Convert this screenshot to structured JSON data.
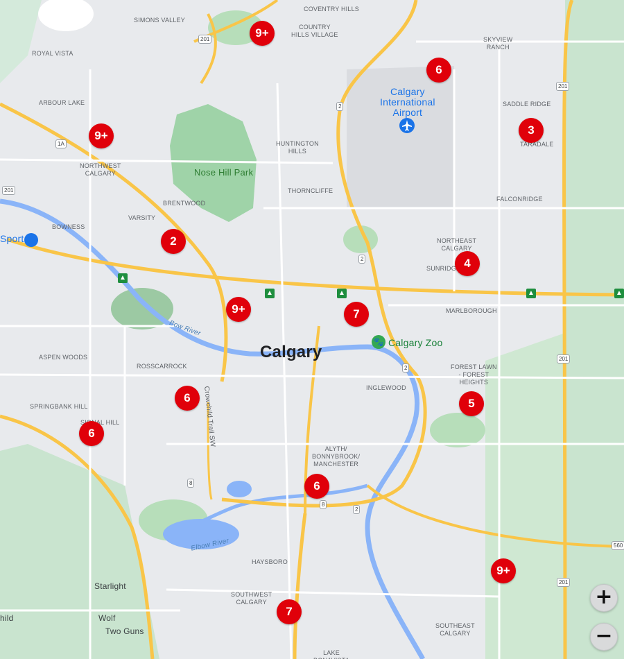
{
  "map": {
    "city_label": "Calgary",
    "park_label": "Nose Hill Park",
    "airport_label": "Calgary\nInternational\nAirport",
    "zoo_label": "Calgary Zoo",
    "sport_label": "Sport",
    "river_bow": "Bow River",
    "river_elbow": "Elbow River",
    "road_crowchild": "Crowchild Trail SW",
    "neighborhoods": {
      "simons_valley": "SIMONS VALLEY",
      "coventry_hills": "COVENTRY HILLS",
      "country_hills_village": "COUNTRY\nHILLS VILLAGE",
      "royal_vista": "ROYAL VISTA",
      "skyview_ranch": "SKYVIEW\nRANCH",
      "arbour_lake": "ARBOUR LAKE",
      "saddle_ridge": "SADDLE RIDGE",
      "taradale": "TARADALE",
      "huntington_hills": "HUNTINGTON\nHILLS",
      "northwest_calgary": "NORTHWEST\nCALGARY",
      "thorncliffe": "THORNCLIFFE",
      "falconridge": "FALCONRIDGE",
      "brentwood": "BRENTWOOD",
      "varsity": "VARSITY",
      "bowness": "BOWNESS",
      "northeast_calgary": "NORTHEAST\nCALGARY",
      "sunridge": "SUNRIDGE",
      "marlborough": "MARLBOROUGH",
      "aspen_woods": "ASPEN WOODS",
      "rosscarrock": "ROSSCARROCK",
      "forest_lawn": "FOREST LAWN\n- FOREST\nHEIGHTS",
      "inglewood": "INGLEWOOD",
      "springbank_hill": "SPRINGBANK HILL",
      "signal_hill": "SIGNAL HILL",
      "alyth": "ALYTH/\nBONNYBROOK/\nMANCHESTER",
      "haysboro": "HAYSBORO",
      "southwest_calgary": "SOUTHWEST\nCALGARY",
      "southeast_calgary": "SOUTHEAST\nCALGARY",
      "lake_bonavista": "LAKE\nBONAVISTA"
    },
    "places": {
      "starlight": "Starlight",
      "wolf": "Wolf",
      "two_guns": "Two Guns",
      "hild": "hild"
    },
    "highway_shields": [
      "201",
      "2",
      "1A",
      "201",
      "2",
      "201",
      "2",
      "8",
      "8",
      "2",
      "201",
      "201",
      "560"
    ],
    "clusters": [
      {
        "label": "9+"
      },
      {
        "label": "6"
      },
      {
        "label": "9+"
      },
      {
        "label": "3"
      },
      {
        "label": "2"
      },
      {
        "label": "4"
      },
      {
        "label": "9+"
      },
      {
        "label": "7"
      },
      {
        "label": "6"
      },
      {
        "label": "5"
      },
      {
        "label": "6"
      },
      {
        "label": "6"
      },
      {
        "label": "9+"
      },
      {
        "label": "7"
      }
    ],
    "marker_color": "#e0000a"
  },
  "controls": {
    "zoom_in": "+",
    "zoom_out": "−"
  }
}
